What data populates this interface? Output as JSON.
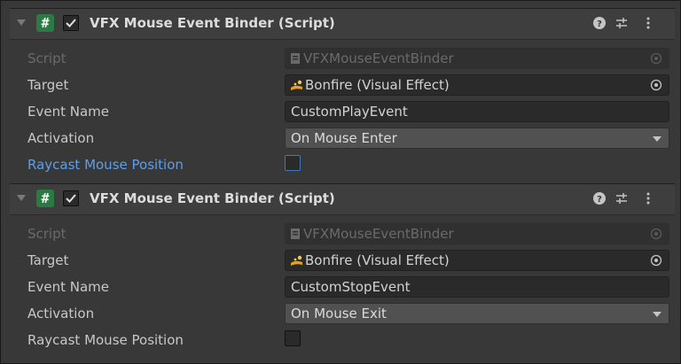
{
  "components": [
    {
      "title": "VFX Mouse Event Binder (Script)",
      "enabled": true,
      "fields": {
        "script_label": "Script",
        "script_value": "VFXMouseEventBinder",
        "target_label": "Target",
        "target_value": "Bonfire (Visual Effect)",
        "event_name_label": "Event Name",
        "event_name_value": "CustomPlayEvent",
        "activation_label": "Activation",
        "activation_value": "On Mouse Enter",
        "raycast_label": "Raycast Mouse Position",
        "raycast_checked": false
      }
    },
    {
      "title": "VFX Mouse Event Binder (Script)",
      "enabled": true,
      "fields": {
        "script_label": "Script",
        "script_value": "VFXMouseEventBinder",
        "target_label": "Target",
        "target_value": "Bonfire (Visual Effect)",
        "event_name_label": "Event Name",
        "event_name_value": "CustomStopEvent",
        "activation_label": "Activation",
        "activation_value": "On Mouse Exit",
        "raycast_label": "Raycast Mouse Position",
        "raycast_checked": false
      }
    }
  ],
  "icons": {
    "component_icon": "script-hash-icon",
    "help": "help-icon",
    "presets": "presets-icon",
    "menu": "kebab-menu-icon"
  },
  "colors": {
    "script_icon_green": "#2c7a43",
    "highlight_label_blue": "#5d9fea",
    "panel_bg": "#383838"
  }
}
